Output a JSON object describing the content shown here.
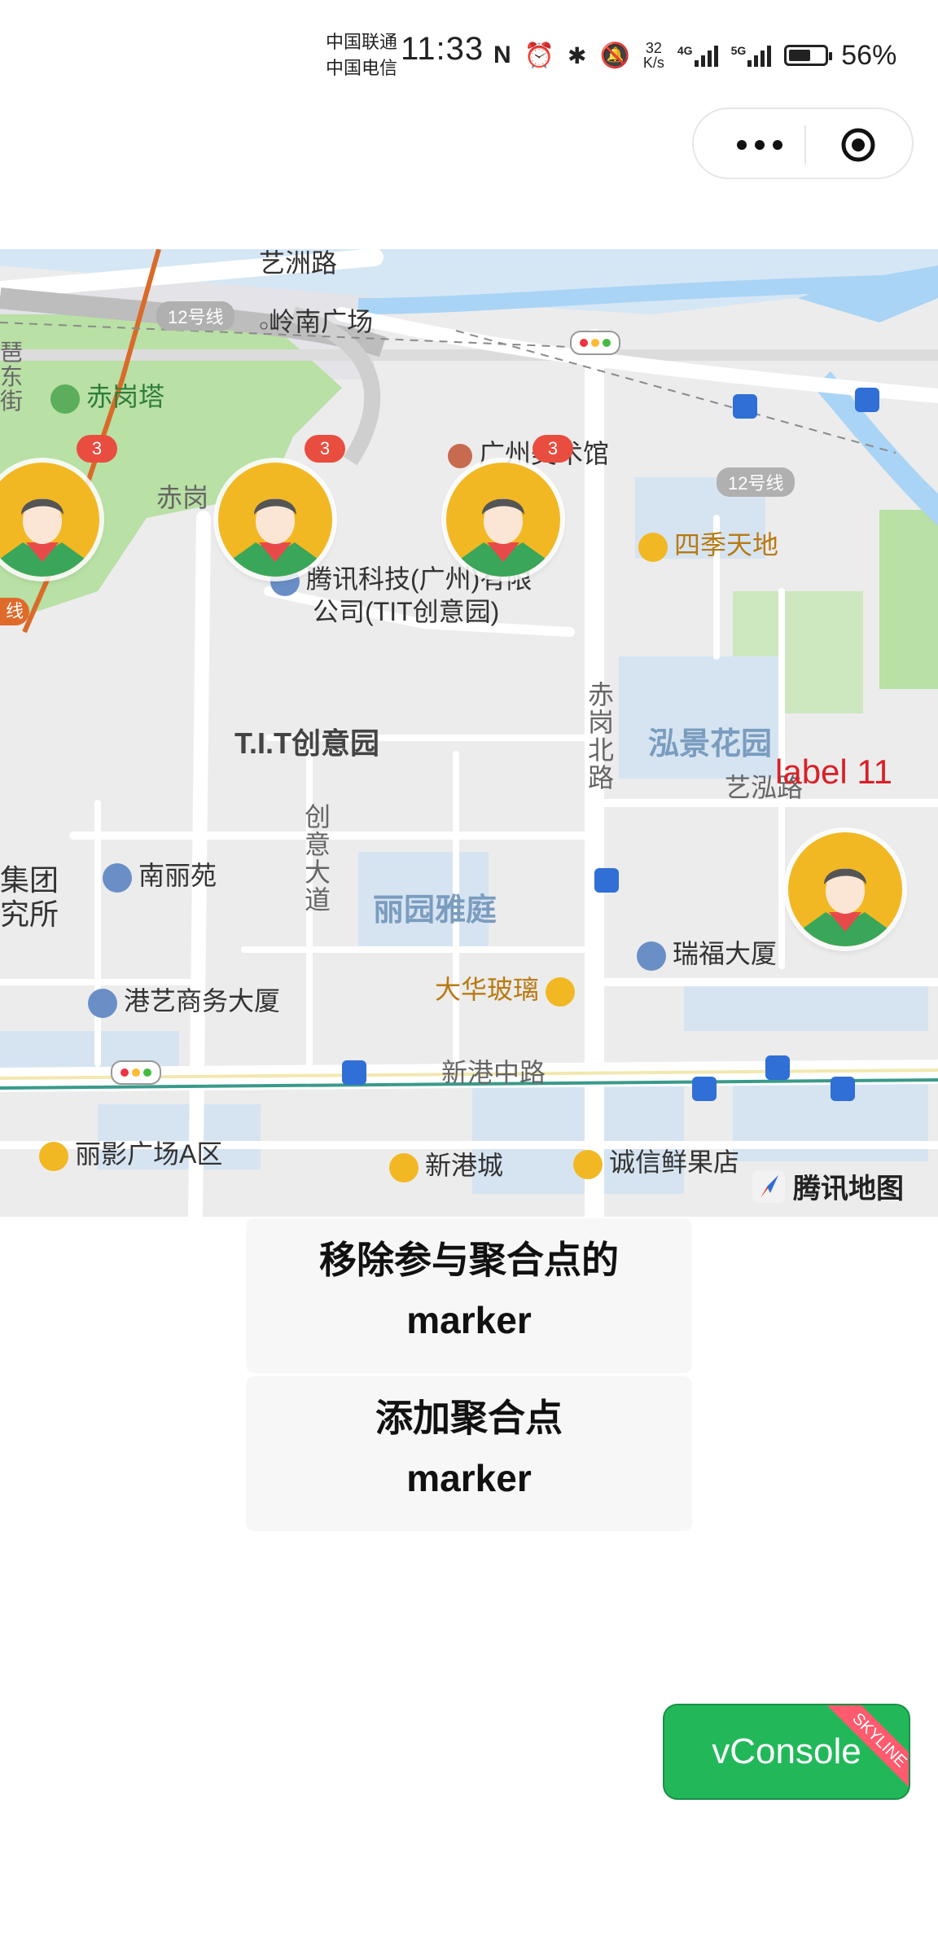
{
  "status": {
    "carrier1": "中国联通",
    "carrier2": "中国电信",
    "time": "11:33",
    "speed_num": "32",
    "speed_unit": "K/s",
    "net1": "4G",
    "net2": "5G",
    "battery": "56%"
  },
  "map": {
    "labels": {
      "yizhou_rd": "艺洲路",
      "line12_a": "12号线",
      "lingnan_sq": "岭南广场",
      "chigang_tower": "赤岗塔",
      "chigang": "赤岗",
      "art_museum": "广州美术馆",
      "line12_b": "12号线",
      "siji": "四季天地",
      "tencent": "腾讯科技(广州)有限",
      "tencent2": "公司(TIT创意园)",
      "tit": "T.I.T创意园",
      "chigang_north": "赤岗北路",
      "hongjing": "泓景花园",
      "yihong": "艺泓路",
      "chuangyi": "创意大道",
      "nanli": "南丽苑",
      "liyuan": "丽园雅庭",
      "jituan": "集团",
      "yuansuo": "究所",
      "ruifu": "瑞福大厦",
      "gangyi": "港艺商务大厦",
      "dahua": "大华玻璃",
      "xingang": "新港中路",
      "liying": "丽影广场A区",
      "xingangcheng": "新港城",
      "chengxin": "诚信鲜果店",
      "line_frag": "线",
      "left_frag1": "琶",
      "left_frag2": "东",
      "left_frag3": "街"
    },
    "badges": [
      "3",
      "3",
      "3"
    ],
    "marker_label": "label 11",
    "provider": "腾讯地图",
    "colors": {
      "water": "#a9d4f5",
      "park": "#b9e0a5",
      "road": "#ffffff",
      "block": "#e4e4e4",
      "metro": "#d96b2a"
    }
  },
  "buttons": {
    "remove_line1": "移除参与聚合点的",
    "remove_line2": "marker",
    "add_line1": "添加聚合点",
    "add_line2": "marker"
  },
  "vconsole": {
    "label": "vConsole",
    "ribbon": "SKYLINE"
  }
}
